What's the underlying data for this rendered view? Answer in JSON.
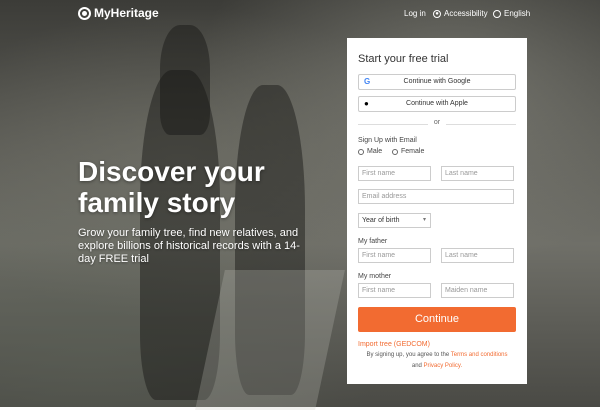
{
  "brand": {
    "name": "MyHeritage"
  },
  "nav": {
    "login": "Log in",
    "accessibility": "Accessibility",
    "language": "English"
  },
  "hero": {
    "headline": "Discover your family story",
    "subtext": "Grow your family tree, find new relatives, and explore billions of historical records with a 14-day FREE trial"
  },
  "signup": {
    "title": "Start your free trial",
    "google_label": "Continue with Google",
    "apple_label": "Continue with Apple",
    "or_label": "or",
    "email_section_label": "Sign Up with Email",
    "gender_male": "Male",
    "gender_female": "Female",
    "first_name_placeholder": "First name",
    "last_name_placeholder": "Last name",
    "email_placeholder": "Email address",
    "year_of_birth": "Year of birth",
    "father_label": "My father",
    "father_first_placeholder": "First name",
    "father_last_placeholder": "Last name",
    "mother_label": "My mother",
    "mother_first_placeholder": "First name",
    "mother_maiden_placeholder": "Maiden name",
    "continue_label": "Continue",
    "import_label": "Import tree (GEDCOM)",
    "legal_prefix": "By signing up, you agree to the",
    "terms_label": "Terms and conditions",
    "legal_and": "and",
    "privacy_label": "Privacy Policy."
  },
  "colors": {
    "accent": "#f26b31",
    "google_g": "#4285f4"
  }
}
